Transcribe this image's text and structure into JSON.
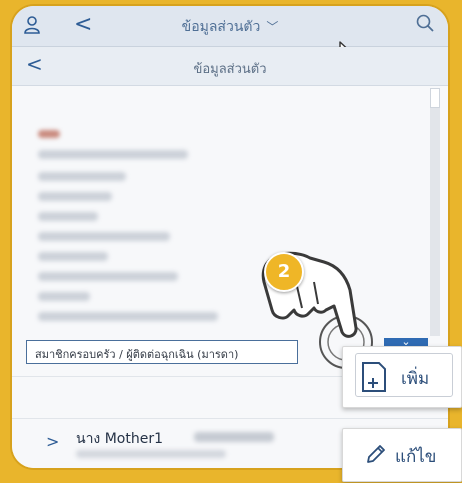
{
  "header": {
    "title": "ข้อมูลส่วนตัว",
    "title_chevron": "﹀",
    "back_glyph": "<"
  },
  "subheader": {
    "title": "ข้อมูลส่วนตัว",
    "back_glyph": "<"
  },
  "family_section": {
    "field_text": "สมาชิกครอบครัว / ผู้ติดต่อฉุกเฉิน (มารดา)",
    "collapse_glyph": "⌄"
  },
  "family_list": [
    {
      "chevron": ">",
      "name": "นาง Mother1"
    }
  ],
  "tutorial": {
    "step_number": "2"
  },
  "actions": {
    "add_label": "เพิ่ม",
    "edit_label": "แก้ไข"
  },
  "colors": {
    "background": "#e9b52c",
    "accent_blue": "#2f6bb3",
    "badge": "#efb627"
  },
  "icons": [
    "user-icon",
    "back-icon",
    "search-icon",
    "cursor-icon",
    "pointing-hand-icon",
    "add-document-icon",
    "pencil-icon"
  ]
}
